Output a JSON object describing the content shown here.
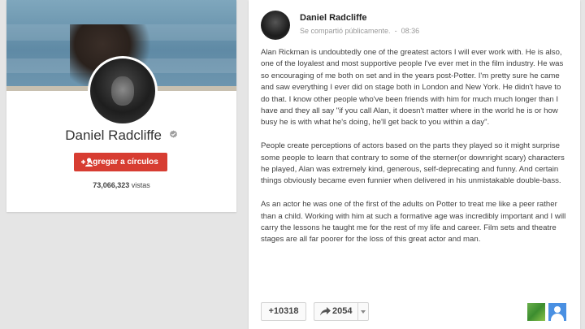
{
  "profile": {
    "name": "Daniel Radcliffe",
    "add_button_label": "Agregar a círculos",
    "views_count": "73,066,323",
    "views_label": "vistas"
  },
  "post": {
    "author": "Daniel Radcliffe",
    "visibility": "Se compartió públicamente.",
    "separator": "-",
    "time": "08:36",
    "paragraphs": [
      "Alan Rickman is undoubtedly one of the greatest actors I will ever work with. He is also, one of the loyalest and most supportive people I've ever met in the film industry. He was so encouraging of me both on set and in the years post-Potter. I'm pretty sure he came and saw everything I ever did on stage both in London and New York. He didn't have to do that. I know other people who've been friends with him for much much longer than I have and they all say \"if you call Alan, it doesn't matter where in the world he is or how busy he is with what he's doing, he'll get back to you within a day\".",
      "People create perceptions of actors based on the parts they played so it might surprise some people to learn that contrary to some of the sterner(or downright scary) characters he played, Alan was extremely kind, generous, self-deprecating and funny. And certain things obviously became even funnier when delivered in his unmistakable double-bass.",
      "As an actor he was one of the first of the adults on Potter to treat me like a peer rather than a child. Working with him at such a formative age was incredibly important and I will carry the lessons he taught me for the rest of my life and career. Film sets and theatre stages are all far poorer for the loss of this great actor and man."
    ],
    "plus_count": "+10318",
    "share_count": "2054"
  },
  "colors": {
    "accent": "#d73d32",
    "page_background": "#e5e5e5"
  },
  "icons": {
    "verified": "verified-check-icon",
    "add_person": "add-person-icon",
    "share": "share-arrow-icon",
    "dropdown": "chevron-down-icon"
  }
}
